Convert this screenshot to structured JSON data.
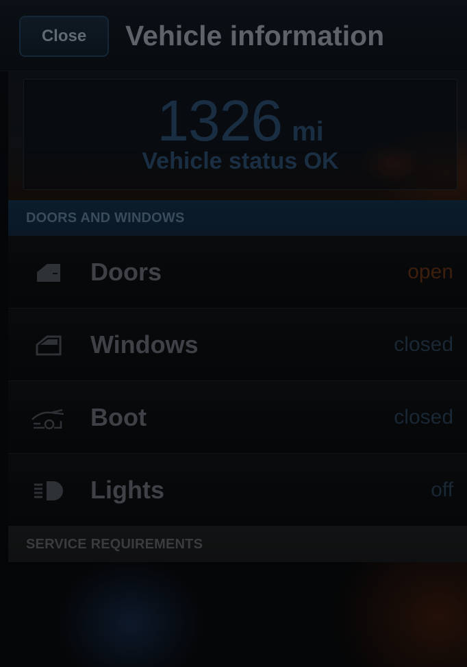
{
  "header": {
    "close_label": "Close",
    "title": "Vehicle information"
  },
  "odometer": {
    "value": "1326",
    "unit": "mi",
    "status": "Vehicle status OK"
  },
  "sections": {
    "doors_windows": "DOORS AND WINDOWS",
    "service": "SERVICE REQUIREMENTS"
  },
  "rows": [
    {
      "icon": "door-icon",
      "label": "Doors",
      "value": "open"
    },
    {
      "icon": "window-icon",
      "label": "Windows",
      "value": "closed"
    },
    {
      "icon": "car-boot-icon",
      "label": "Boot",
      "value": "closed"
    },
    {
      "icon": "headlight-icon",
      "label": "Lights",
      "value": "off"
    }
  ],
  "colors": {
    "status_open": "#3e1f0e",
    "status_closed": "#1a2735",
    "section_accent": "#0b1c2c",
    "odometer_text": "#1a2e43"
  }
}
